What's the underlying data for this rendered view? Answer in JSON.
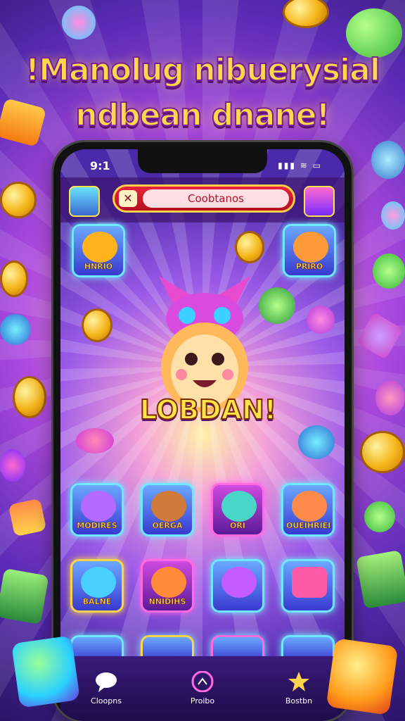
{
  "headline": {
    "line1": "!Manolug nibuerysial",
    "line2": "ndbean dnane!"
  },
  "status_bar": {
    "time": "9:1",
    "icons": "▮▮▮ ≋ ▭"
  },
  "search": {
    "close_glyph": "✕",
    "text": "Coobtanos"
  },
  "logo": {
    "text": "LOBDAN!"
  },
  "tiles": [
    {
      "label": "HNRIO",
      "color": "#ffb31a"
    },
    {
      "label": "PRIRO",
      "color": "#ff9a3a"
    },
    {
      "label": "MODIRES",
      "color": "#b46aff"
    },
    {
      "label": "OERGA",
      "color": "#d07a3a"
    },
    {
      "label": "ORI",
      "color": "#4ad6c6"
    },
    {
      "label": "OUEIHRIEI",
      "color": "#ff8a4a"
    },
    {
      "label": "BALNE",
      "color": "#4ad0ff"
    },
    {
      "label": "NNIDIHS",
      "color": "#ff8a3a"
    },
    {
      "label": "",
      "color": "#c45cff"
    },
    {
      "label": "",
      "color": "#ff5aa8"
    }
  ],
  "nav": [
    {
      "label": "Cloopns",
      "icon": "chat-icon"
    },
    {
      "label": "Proibo",
      "icon": "profile-icon"
    },
    {
      "label": "Bostbn",
      "icon": "star-icon"
    }
  ]
}
